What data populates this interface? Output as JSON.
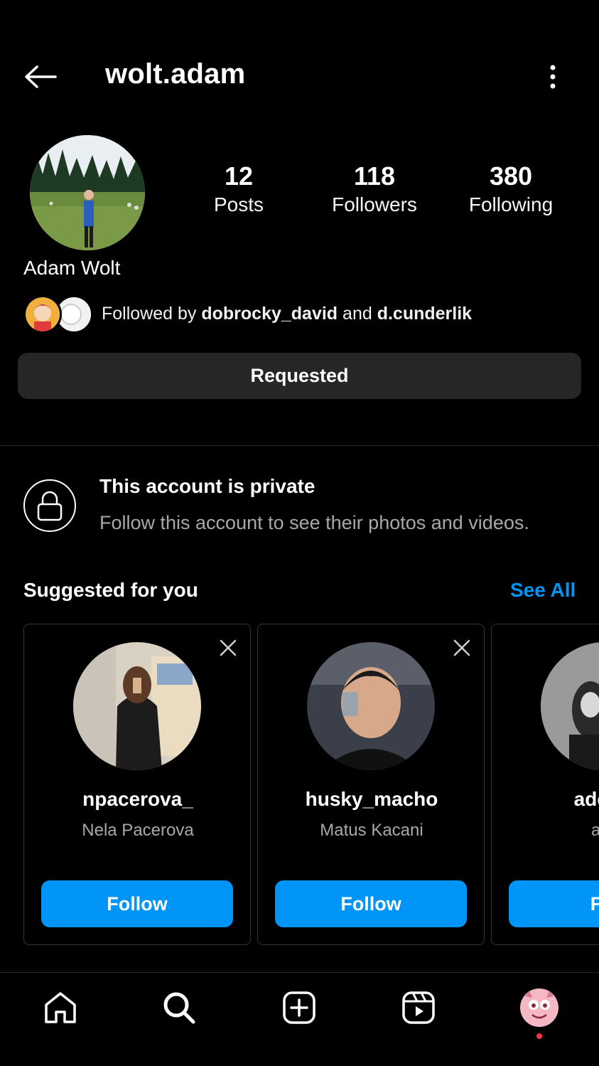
{
  "header": {
    "username": "wolt.adam",
    "back_icon": "arrow-left-icon",
    "more_icon": "more-vertical-icon"
  },
  "profile": {
    "full_name": "Adam Wolt",
    "stats": [
      {
        "value": "12",
        "label": "Posts"
      },
      {
        "value": "118",
        "label": "Followers"
      },
      {
        "value": "380",
        "label": "Following"
      }
    ],
    "followed_by_prefix": "Followed by",
    "followed_by_user1": "dobrocky_david",
    "followed_by_and": "and",
    "followed_by_user2": "d.cunderlik",
    "action_button": "Requested"
  },
  "private_notice": {
    "title": "This account is private",
    "subtitle": "Follow this account to see their photos and videos."
  },
  "suggested": {
    "title": "Suggested for you",
    "see_all": "See All",
    "cards": [
      {
        "handle": "npacerova_",
        "name": "Nela Pacerova",
        "button": "Follow"
      },
      {
        "handle": "husky_macho",
        "name": "Matus Kacani",
        "button": "Follow"
      },
      {
        "handle": "adel_b",
        "name": "ade",
        "button": "Fol"
      }
    ]
  },
  "bottom_nav": {
    "items": [
      "home-icon",
      "search-icon",
      "create-icon",
      "reels-icon",
      "profile-avatar"
    ]
  },
  "colors": {
    "background": "#000000",
    "accent": "#0095f6",
    "secondary_button": "#262626",
    "muted_text": "#a8a8a8",
    "notification_dot": "#ff3040"
  }
}
